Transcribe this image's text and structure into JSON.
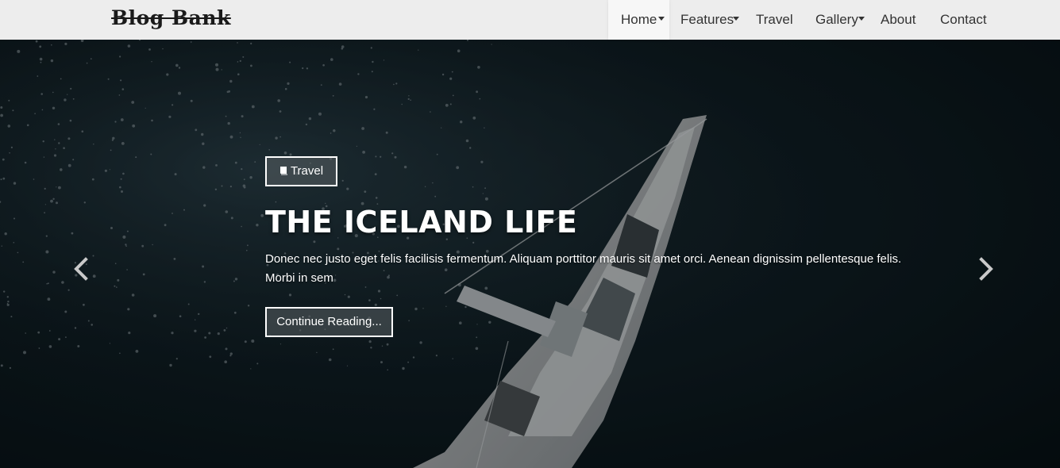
{
  "brand": {
    "name": "Blog Bank"
  },
  "nav": {
    "items": [
      {
        "label": "Home",
        "dropdown": true,
        "active": true
      },
      {
        "label": "Features",
        "dropdown": true
      },
      {
        "label": "Travel",
        "dropdown": false
      },
      {
        "label": "Gallery",
        "dropdown": true
      },
      {
        "label": "About",
        "dropdown": false
      },
      {
        "label": "Contact",
        "dropdown": false
      }
    ]
  },
  "hero": {
    "category": {
      "label": "Travel",
      "icon": "book-icon"
    },
    "title": "THE ICELAND LIFE",
    "text": "Donec nec justo eget felis facilisis fermentum. Aliquam porttitor mauris sit amet orci. Aenean dignissim pellentesque felis. Morbi in sem",
    "cta_label": "Continue Reading...",
    "prev_icon": "chevron-left-icon",
    "next_icon": "chevron-right-icon"
  },
  "colors": {
    "navbar": "#ededed",
    "overlay_button": "#5a6064",
    "text": "#ffffff"
  }
}
